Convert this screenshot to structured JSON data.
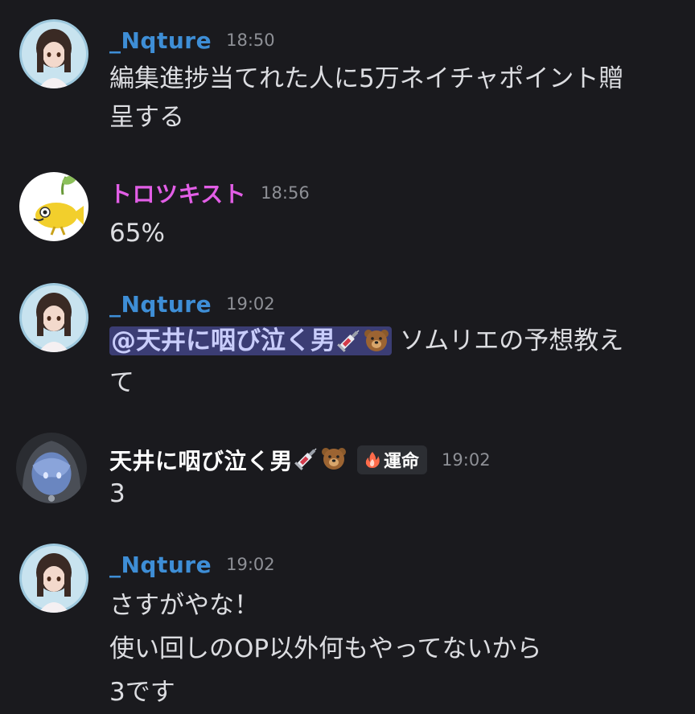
{
  "messages": [
    {
      "author": "_Nqture",
      "time": "18:50",
      "lines": [
        "編集進捗当てれた人に5万ネイチャポイント贈",
        "呈する"
      ]
    },
    {
      "author": "トロツキスト",
      "time": "18:56",
      "lines": [
        "65%"
      ]
    },
    {
      "author": "_Nqture",
      "time": "19:02",
      "mention": "@天井に咽び泣く男",
      "mention_emojis": [
        "syringe-icon",
        "bear-icon"
      ],
      "line1_rest": " ソムリエの予想教え",
      "line2": "て"
    },
    {
      "author": "天井に咽び泣く男",
      "author_emojis": [
        "syringe-icon",
        "bear-icon"
      ],
      "tag": "運命",
      "tag_icon": "flame-icon",
      "time": "19:02",
      "lines": [
        "3"
      ]
    },
    {
      "author": "_Nqture",
      "time": "19:02",
      "lines": [
        "さすがやな！",
        "使い回しのOP以外何もやってないから",
        "3です"
      ]
    }
  ],
  "colors": {
    "background": "#1a1a1e",
    "nqture_name": "#3e8ed6",
    "trotskyist_name": "#e25ee6",
    "tenjou_name": "#ffffff",
    "mention_bg": "#3b3d74",
    "timestamp": "#8e9096"
  }
}
